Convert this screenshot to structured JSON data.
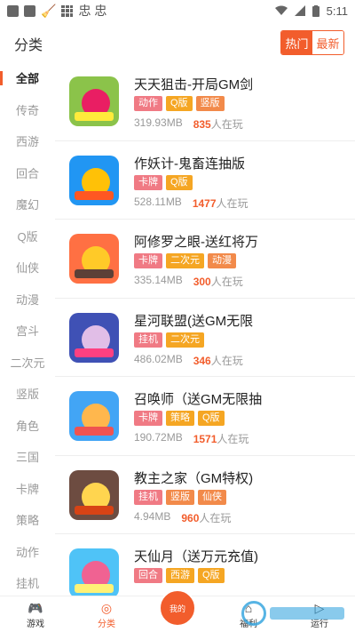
{
  "status_bar": {
    "time": "5:11",
    "notif_glyph": "忠 忠"
  },
  "header": {
    "title": "分类",
    "tabs": [
      {
        "label": "热门",
        "active": true
      },
      {
        "label": "最新",
        "active": false
      }
    ]
  },
  "sidebar": {
    "items": [
      "全部",
      "传奇",
      "西游",
      "回合",
      "魔幻",
      "Q版",
      "仙侠",
      "动漫",
      "宫斗",
      "二次元",
      "竖版",
      "角色",
      "三国",
      "卡牌",
      "策略",
      "动作",
      "挂机"
    ],
    "active_index": 0
  },
  "tag_colors": {
    "动作": "#f07a84",
    "Q版": "#f5a623",
    "竖版": "#f28a4a",
    "卡牌": "#f07a84",
    "二次元": "#f5a623",
    "动漫": "#f28a4a",
    "挂机": "#f07a84",
    "策略": "#f5a623",
    "仙侠": "#f28a4a",
    "回合": "#f07a84",
    "西游": "#f5a623"
  },
  "games": [
    {
      "name": "天天狙击-开局GM剑",
      "tags": [
        "动作",
        "Q版",
        "竖版"
      ],
      "size": "319.93MB",
      "players": "835",
      "players_suffix": "人在玩",
      "icon": "game-icon-sniper"
    },
    {
      "name": "作妖计-鬼畜连抽版",
      "tags": [
        "卡牌",
        "Q版"
      ],
      "size": "528.11MB",
      "players": "1477",
      "players_suffix": "人在玩",
      "icon": "game-icon-zuoyaoji"
    },
    {
      "name": "阿修罗之眼-送红将万",
      "tags": [
        "卡牌",
        "二次元",
        "动漫"
      ],
      "size": "335.14MB",
      "players": "300",
      "players_suffix": "人在玩",
      "icon": "game-icon-asura"
    },
    {
      "name": "星河联盟(送GM无限",
      "tags": [
        "挂机",
        "二次元"
      ],
      "size": "486.02MB",
      "players": "346",
      "players_suffix": "人在玩",
      "icon": "game-icon-galaxy"
    },
    {
      "name": "召唤师（送GM无限抽",
      "tags": [
        "卡牌",
        "策略",
        "Q版"
      ],
      "size": "190.72MB",
      "players": "1571",
      "players_suffix": "人在玩",
      "icon": "game-icon-summoner"
    },
    {
      "name": "教主之家（GM特权)",
      "tags": [
        "挂机",
        "竖版",
        "仙侠"
      ],
      "size": "4.94MB",
      "players": "960",
      "players_suffix": "人在玩",
      "icon": "game-icon-jiaozhu"
    },
    {
      "name": "天仙月（送万元充值)",
      "tags": [
        "回合",
        "西游",
        "Q版"
      ],
      "size": "",
      "players": "",
      "players_suffix": "",
      "icon": "game-icon-tianxianyue"
    }
  ],
  "bottom_nav": [
    {
      "label": "游戏",
      "icon": "gamepad-icon",
      "active": false
    },
    {
      "label": "分类",
      "icon": "category-icon",
      "active": true
    },
    {
      "label": "我的",
      "icon": "profile-icon",
      "active": false
    },
    {
      "label": "福利",
      "icon": "gift-icon",
      "active": false
    },
    {
      "label": "运行",
      "icon": "run-icon",
      "active": false
    }
  ]
}
